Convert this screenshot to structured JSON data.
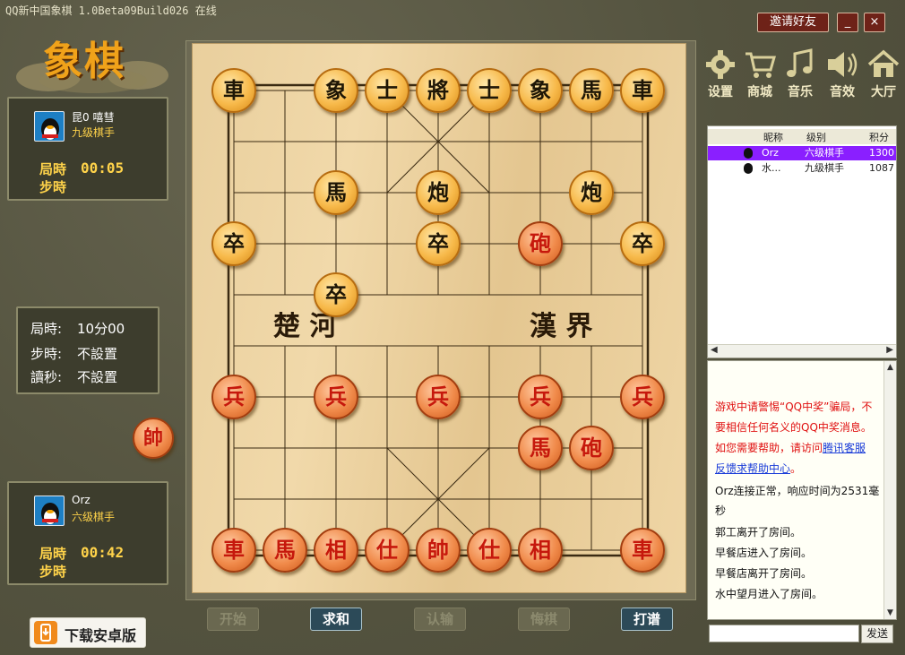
{
  "window": {
    "title": "QQ新中国象棋 1.0Beta09Build026 在线",
    "invite_label": "邀请好友",
    "minimize_label": "_",
    "close_label": "×"
  },
  "logo": {
    "text": "象棋"
  },
  "opponent": {
    "name": "昆0 嘻彗",
    "rank": "九级棋手",
    "total_time_label": "局時",
    "total_time": "00:05",
    "step_time_label": "步時",
    "step_time": ""
  },
  "rules": {
    "total_label": "局時:",
    "total_value": "10分00",
    "step_label": "步時:",
    "step_value": "不設置",
    "count_label": "讀秒:",
    "count_value": "不設置"
  },
  "side_piece": {
    "text": "帥"
  },
  "self": {
    "name": "Orz",
    "rank": "六级棋手",
    "total_time_label": "局時",
    "total_time": "00:42",
    "step_time_label": "步時",
    "step_time": ""
  },
  "download": {
    "label": "下载安卓版"
  },
  "toolbar": [
    {
      "label": "设置",
      "icon": "gear-icon"
    },
    {
      "label": "商城",
      "icon": "cart-icon"
    },
    {
      "label": "音乐",
      "icon": "music-icon"
    },
    {
      "label": "音效",
      "icon": "speaker-icon"
    },
    {
      "label": "大厅",
      "icon": "home-icon"
    }
  ],
  "board": {
    "river_left": "楚 河",
    "river_right": "漢 界",
    "pieces": [
      {
        "text": "車",
        "side": "black",
        "col": 0,
        "row": 0
      },
      {
        "text": "象",
        "side": "black",
        "col": 2,
        "row": 0
      },
      {
        "text": "士",
        "side": "black",
        "col": 3,
        "row": 0
      },
      {
        "text": "將",
        "side": "black",
        "col": 4,
        "row": 0
      },
      {
        "text": "士",
        "side": "black",
        "col": 5,
        "row": 0
      },
      {
        "text": "象",
        "side": "black",
        "col": 6,
        "row": 0
      },
      {
        "text": "馬",
        "side": "black",
        "col": 7,
        "row": 0
      },
      {
        "text": "車",
        "side": "black",
        "col": 8,
        "row": 0
      },
      {
        "text": "馬",
        "side": "black",
        "col": 2,
        "row": 2
      },
      {
        "text": "炮",
        "side": "black",
        "col": 4,
        "row": 2
      },
      {
        "text": "炮",
        "side": "black",
        "col": 7,
        "row": 2
      },
      {
        "text": "卒",
        "side": "black",
        "col": 0,
        "row": 3
      },
      {
        "text": "卒",
        "side": "black",
        "col": 4,
        "row": 3
      },
      {
        "text": "砲",
        "side": "red",
        "col": 6,
        "row": 3
      },
      {
        "text": "卒",
        "side": "black",
        "col": 8,
        "row": 3
      },
      {
        "text": "卒",
        "side": "black",
        "col": 2,
        "row": 4
      },
      {
        "text": "兵",
        "side": "red",
        "col": 0,
        "row": 6
      },
      {
        "text": "兵",
        "side": "red",
        "col": 2,
        "row": 6
      },
      {
        "text": "兵",
        "side": "red",
        "col": 4,
        "row": 6
      },
      {
        "text": "兵",
        "side": "red",
        "col": 6,
        "row": 6
      },
      {
        "text": "兵",
        "side": "red",
        "col": 8,
        "row": 6
      },
      {
        "text": "馬",
        "side": "red",
        "col": 6,
        "row": 7
      },
      {
        "text": "砲",
        "side": "red",
        "col": 7,
        "row": 7
      },
      {
        "text": "車",
        "side": "red",
        "col": 0,
        "row": 9
      },
      {
        "text": "馬",
        "side": "red",
        "col": 1,
        "row": 9
      },
      {
        "text": "相",
        "side": "red",
        "col": 2,
        "row": 9
      },
      {
        "text": "仕",
        "side": "red",
        "col": 3,
        "row": 9
      },
      {
        "text": "帥",
        "side": "red",
        "col": 4,
        "row": 9
      },
      {
        "text": "仕",
        "side": "red",
        "col": 5,
        "row": 9
      },
      {
        "text": "相",
        "side": "red",
        "col": 6,
        "row": 9
      },
      {
        "text": "車",
        "side": "red",
        "col": 8,
        "row": 9
      }
    ]
  },
  "controls": [
    {
      "label": "开始",
      "enabled": false
    },
    {
      "label": "求和",
      "enabled": true
    },
    {
      "label": "认输",
      "enabled": false
    },
    {
      "label": "悔棋",
      "enabled": false
    },
    {
      "label": "打谱",
      "enabled": true
    }
  ],
  "players_list": {
    "headers": [
      "昵称",
      "级别",
      "积分"
    ],
    "rows": [
      {
        "name": "Orz",
        "rank": "六级棋手",
        "score": "1300",
        "selected": true
      },
      {
        "name": "水...",
        "rank": "九级棋手",
        "score": "1087",
        "selected": false
      }
    ]
  },
  "chat": {
    "lines": [
      {
        "text": "游戏中请警惕“QQ中奖”骗局，不要相信任何名义的QQ中奖消息。如您需要帮助，请访问",
        "link": "腾讯客服反馈求帮助中心",
        "tail": "。",
        "color": "#e01010"
      },
      {
        "text": "Orz连接正常，响应时间为2531毫秒",
        "color": "#111111"
      },
      {
        "text": "郭工离开了房间。",
        "color": "#111111"
      },
      {
        "text": "早餐店进入了房间。",
        "color": "#111111"
      },
      {
        "text": "早餐店离开了房间。",
        "color": "#111111"
      },
      {
        "text": "水中望月进入了房间。",
        "color": "#111111"
      }
    ],
    "input_value": "",
    "send_label": "发送"
  }
}
